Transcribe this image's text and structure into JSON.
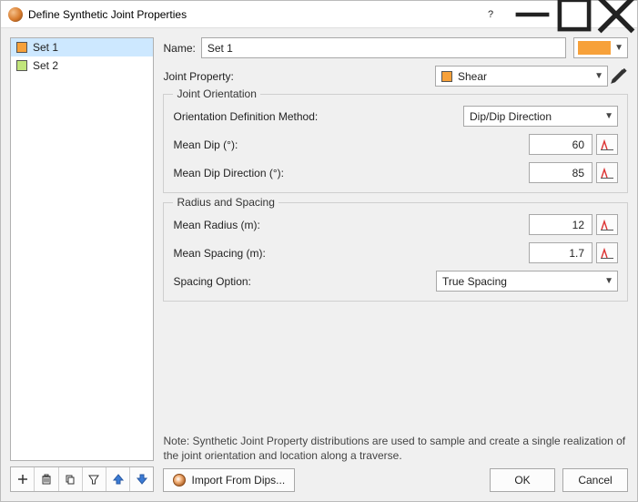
{
  "window": {
    "title": "Define Synthetic Joint Properties"
  },
  "sets": [
    {
      "label": "Set 1",
      "color": "#f7a13a",
      "selected": true
    },
    {
      "label": "Set 2",
      "color": "#c1e57b",
      "selected": false
    }
  ],
  "form": {
    "name_label": "Name:",
    "name_value": "Set 1",
    "color_value": "#f7a13a",
    "joint_property_label": "Joint Property:",
    "joint_property_value": "Shear",
    "joint_property_swatch": "#f7a13a"
  },
  "orientation": {
    "legend": "Joint Orientation",
    "method_label": "Orientation Definition Method:",
    "method_value": "Dip/Dip Direction",
    "dip_label": "Mean Dip (°):",
    "dip_value": "60",
    "dipdir_label": "Mean Dip Direction (°):",
    "dipdir_value": "85"
  },
  "radius_spacing": {
    "legend": "Radius and Spacing",
    "radius_label": "Mean Radius (m):",
    "radius_value": "12",
    "spacing_label": "Mean Spacing (m):",
    "spacing_value": "1.7",
    "option_label": "Spacing Option:",
    "option_value": "True Spacing"
  },
  "note": "Note: Synthetic Joint Property distributions are used to sample and create a single realization of the joint orientation and location along a traverse.",
  "buttons": {
    "import": "Import From Dips...",
    "ok": "OK",
    "cancel": "Cancel"
  }
}
